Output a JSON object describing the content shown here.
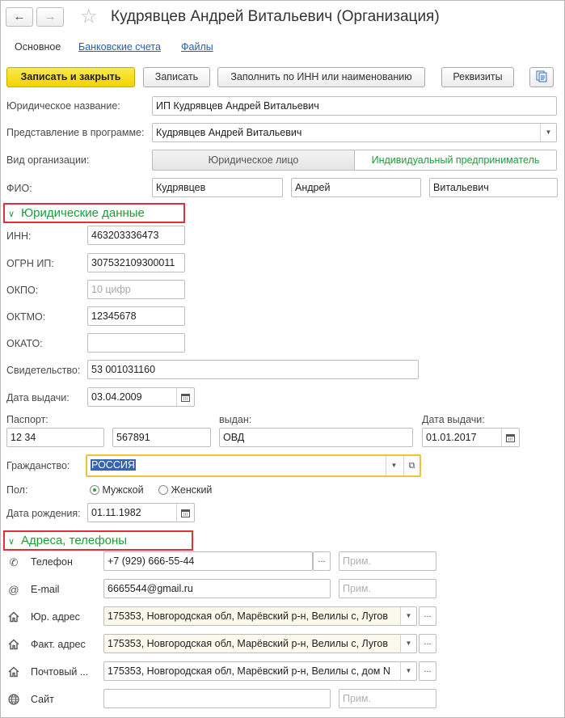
{
  "window": {
    "title": "Кудрявцев Андрей Витальевич (Организация)"
  },
  "tabs": [
    "Основное",
    "Банковские счета",
    "Файлы"
  ],
  "toolbar": {
    "save_close": "Записать и закрыть",
    "save": "Записать",
    "fill": "Заполнить по ИНН или наименованию",
    "requisites": "Реквизиты"
  },
  "header": {
    "legal_name_label": "Юридическое название:",
    "legal_name": "ИП Кудрявцев Андрей Витальевич",
    "display_label": "Представление в программе:",
    "display": "Кудрявцев Андрей Витальевич",
    "org_type_label": "Вид организации:",
    "org_type_options": [
      "Юридическое лицо",
      "Индивидуальный предприниматель"
    ],
    "fio_label": "ФИО:",
    "last_name": "Кудрявцев",
    "first_name": "Андрей",
    "middle_name": "Витальевич"
  },
  "legal": {
    "section_title": "Юридические данные",
    "inn_label": "ИНН:",
    "inn": "463203336473",
    "ogrn_label": "ОГРН ИП:",
    "ogrn": "307532109300011",
    "okpo_label": "ОКПО:",
    "okpo_placeholder": "10 цифр",
    "oktmo_label": "ОКТМО:",
    "oktmo": "12345678",
    "okato_label": "ОКАТО:",
    "okato": "",
    "cert_label": "Свидетельство:",
    "cert": "53 001031160",
    "issue_date_label": "Дата выдачи:",
    "issue_date": "03.04.2009",
    "passport_label": "Паспорт:",
    "passport_series": "12 34",
    "passport_number": "567891",
    "issued_by_label": "выдан:",
    "issued_by": "ОВД",
    "passport_date_label": "Дата выдачи:",
    "passport_date": "01.01.2017",
    "citizenship_label": "Гражданство:",
    "citizenship": "РОССИЯ",
    "sex_label": "Пол:",
    "sex_male": "Мужской",
    "sex_female": "Женский",
    "birth_label": "Дата рождения:",
    "birth": "01.11.1982"
  },
  "contacts": {
    "section_title": "Адреса, телефоны",
    "note_placeholder": "Прим.",
    "phone_label": "Телефон",
    "phone": "+7 (929) 666-55-44",
    "email_label": "E-mail",
    "email": "6665544@gmail.ru",
    "legal_addr_label": "Юр. адрес",
    "legal_addr": "175353, Новгородская обл, Марёвский р-н, Велилы с, Лугов",
    "fact_addr_label": "Факт. адрес",
    "fact_addr": "175353, Новгородская обл, Марёвский р-н, Велилы с, Лугов",
    "post_addr_label": "Почтовый ...",
    "post_addr": "175353, Новгородская обл, Марёвский р-н, Велилы с, дом N",
    "site_label": "Сайт",
    "site": ""
  },
  "colors": {
    "accent_green": "#1b9e3a",
    "primary_yellow": "#f4d300",
    "highlight_red": "#e0303a",
    "focus_orange": "#f0c23a"
  }
}
